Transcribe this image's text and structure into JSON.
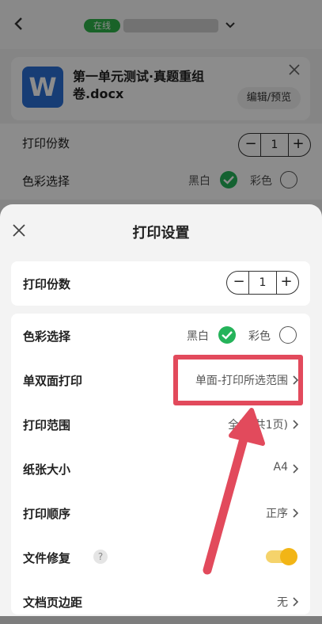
{
  "topbar": {
    "status": "在线"
  },
  "doc": {
    "icon_letter": "W",
    "title": "第一单元测试·真题重组卷.docx",
    "edit_label": "编辑/预览"
  },
  "background": {
    "copies_label": "打印份数",
    "copies_value": "1",
    "color_label": "色彩选择",
    "bw_label": "黑白",
    "color_option_label": "彩色"
  },
  "sheet": {
    "title": "打印设置",
    "copies": {
      "label": "打印份数",
      "value": "1",
      "minus": "−",
      "plus": "+"
    },
    "color": {
      "label": "色彩选择",
      "bw": "黑白",
      "color": "彩色"
    },
    "duplex": {
      "label": "单双面打印",
      "value": "单面-打印所选范围"
    },
    "range": {
      "label": "打印范围",
      "value": "全部(共1页)"
    },
    "paper": {
      "label": "纸张大小",
      "value": "A4"
    },
    "order": {
      "label": "打印顺序",
      "value": "正序"
    },
    "repair": {
      "label": "文件修复",
      "help": "?"
    },
    "partial": {
      "label": "文档页边距",
      "value": "无"
    }
  },
  "colors": {
    "accent_green": "#25b35a",
    "highlight_red": "#e24a5c",
    "toggle_yellow": "#f2b516"
  }
}
